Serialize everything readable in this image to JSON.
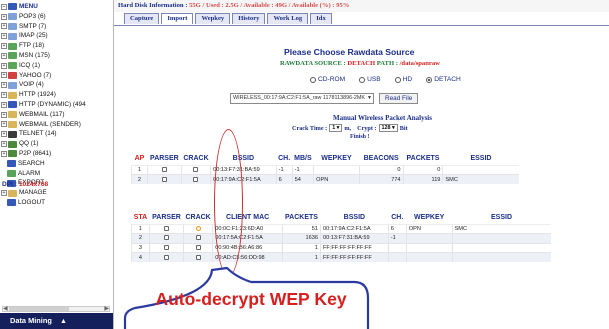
{
  "tree": {
    "items": [
      {
        "label": "MENU",
        "root": true,
        "icon_color": "#3458b8"
      },
      {
        "label": "POP3 (6)",
        "icon_color": "#7fa1d8"
      },
      {
        "label": "SMTP (7)",
        "icon_color": "#7fa1d8"
      },
      {
        "label": "IMAP (25)",
        "icon_color": "#7fa1d8"
      },
      {
        "label": "FTP (18)",
        "icon_color": "#5aa55a"
      },
      {
        "label": "MSN (175)",
        "icon_color": "#5aa55a"
      },
      {
        "label": "ICQ (1)",
        "icon_color": "#5aa55a"
      },
      {
        "label": "YAHOO (7)",
        "icon_color": "#d24040"
      },
      {
        "label": "VOIP (4)",
        "icon_color": "#7fa1d8"
      },
      {
        "label": "HTTP (1924)",
        "icon_color": "#d8b45a"
      },
      {
        "label": "HTTP (DYNAMIC) (494",
        "icon_color": "#3458b8"
      },
      {
        "label": "WEBMAIL (117)",
        "icon_color": "#d8b45a"
      },
      {
        "label": "WEBMAIL (SENDER)",
        "icon_color": "#d8b45a"
      },
      {
        "label": "TELNET (14)",
        "icon_color": "#3b3b3b"
      },
      {
        "label": "QQ (1)",
        "icon_color": "#4a8a3a"
      },
      {
        "label": "P2P (8641)",
        "icon_color": "#4a8a3a"
      },
      {
        "label": "SEARCH",
        "sub": true,
        "icon_color": "#3458b8"
      },
      {
        "label": "ALARM",
        "sub": true,
        "icon_color": "#5aa55a"
      },
      {
        "label": "EXPORT",
        "sub": true,
        "icon_color": "#3458b8"
      },
      {
        "label": "MANAGE",
        "icon_color": "#d8b45a"
      },
      {
        "label": "LOGOUT",
        "sub": true,
        "icon_color": "#3458b8"
      }
    ],
    "dpi_label": "DPI :",
    "dpi_value": "1024x768",
    "footer_label": "Data Mining",
    "footer_caret": "▲"
  },
  "infobar": {
    "prefix": "Hard Disk Information : ",
    "size": "55G",
    "sep1": " / ",
    "used_label": "Used : ",
    "used": "2.5G",
    "sep2": " / ",
    "avail_label": "Available : ",
    "avail": "49G",
    "sep3": " / ",
    "availpct_label": "Available (%) : ",
    "availpct": "95%"
  },
  "tabs": [
    "Capture",
    "Import",
    "Wepkey",
    "History",
    "Work Log",
    "Idx"
  ],
  "active_tab": 1,
  "panel": {
    "title": "Please Choose Rawdata Source",
    "rawsource_label": "RAWDATA SOURCE : ",
    "rawsource_value": "DETACH",
    "path_label": " PATH : ",
    "path_value": "/data/spanraw",
    "radios": [
      {
        "label": "CD-ROM",
        "on": false
      },
      {
        "label": "USB",
        "on": false
      },
      {
        "label": "HD",
        "on": false
      },
      {
        "label": "DETACH",
        "on": true
      }
    ],
    "file_value": "WIRELESS_00:17:9A:C2:F1:5A_raw 1178113896-2MK",
    "read_button": "Read File"
  },
  "analysis": {
    "title": "Manual Wireless Packet Analysis",
    "crack_time_label": "Crack Time : ",
    "crack_time_value": "1",
    "crack_time_unit": "m,",
    "crypt_label": "Crypt :",
    "crypt_value": "128",
    "crypt_unit": "Bit",
    "status": "Finish !"
  },
  "ap_table": {
    "headers": [
      "AP",
      "PARSER",
      "CRACK",
      "BSSID",
      "CH.",
      "MB/S",
      "WEPKEY",
      "BEACONS",
      "PACKETS",
      "ESSID"
    ],
    "rows": [
      [
        "1",
        "",
        "",
        "00:13:F7:31:BA:59",
        "-1",
        "-1",
        "",
        "0",
        "0",
        ""
      ],
      [
        "2",
        "",
        "",
        "00:17:9A:C2:F1:5A",
        "6",
        "54",
        "OPN",
        "774",
        "119",
        "SMC"
      ]
    ]
  },
  "sta_table": {
    "headers": [
      "STA",
      "PARSER",
      "CRACK",
      "CLIENT MAC",
      "PACKETS",
      "BSSID",
      "CH.",
      "WEPKEY",
      "ESSID"
    ],
    "rows": [
      [
        "1",
        "",
        "",
        "00:0C:F1:23:6D:A0",
        "51",
        "00:17:9A:C2:F1:5A",
        "6",
        "OPN",
        "SMC"
      ],
      [
        "2",
        "",
        "",
        "00:17:5A:C2:F1:5A",
        "1636",
        "00:13:F7:31:BA:59",
        "-1",
        "",
        ""
      ],
      [
        "3",
        "",
        "",
        "00:90:4B:B6:A6:86",
        "1",
        "FF:FF:FF:FF:FF:FF",
        "",
        "",
        ""
      ],
      [
        "4",
        "",
        "",
        "00:AD:C5:56:DD:98",
        "1",
        "FF:FF:FF:FF:FF:FF",
        "",
        "",
        ""
      ]
    ]
  },
  "annotation": {
    "text": "Auto-decrypt WEP Key",
    "color": "#d62020"
  }
}
